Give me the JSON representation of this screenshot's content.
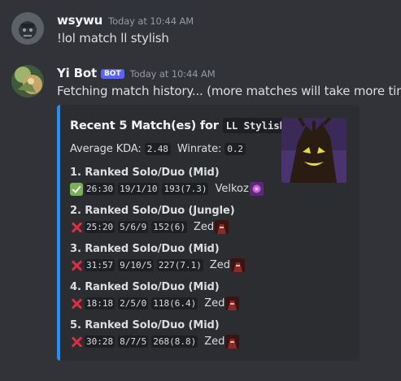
{
  "messages": [
    {
      "author": "wsywu",
      "timestamp": "Today at 10:44 AM",
      "content": "!lol match ll stylish"
    },
    {
      "author": "Yi Bot",
      "bot_tag": "BOT",
      "timestamp": "Today at 10:44 AM",
      "content": "Fetching match history... (more matches will take more time)"
    }
  ],
  "embed": {
    "title_prefix": "Recent 5 Match(es) for",
    "title_code": "LL Stylish",
    "kda_label": "Average KDA:",
    "kda_value": "2.48",
    "winrate_label": "Winrate:",
    "winrate_value": "0.2",
    "accent_color": "#1e90ff",
    "matches": [
      {
        "title": "1.  Ranked Solo/Duo  (Mid)",
        "result": "win",
        "duration": "26:30",
        "kda": "19/1/10",
        "cs": "193(7.3)",
        "champion": "Velkoz"
      },
      {
        "title": "2.  Ranked Solo/Duo  (Jungle)",
        "result": "loss",
        "duration": "25:20",
        "kda": "5/6/9",
        "cs": "152(6)",
        "champion": "Zed"
      },
      {
        "title": "3.  Ranked Solo/Duo  (Mid)",
        "result": "loss",
        "duration": "31:57",
        "kda": "9/10/5",
        "cs": "227(7.1)",
        "champion": "Zed"
      },
      {
        "title": "4.  Ranked Solo/Duo  (Mid)",
        "result": "loss",
        "duration": "18:18",
        "kda": "2/5/0",
        "cs": "118(6.4)",
        "champion": "Zed"
      },
      {
        "title": "5.  Ranked Solo/Duo  (Mid)",
        "result": "loss",
        "duration": "30:28",
        "kda": "8/7/5",
        "cs": "268(8.8)",
        "champion": "Zed"
      }
    ]
  }
}
